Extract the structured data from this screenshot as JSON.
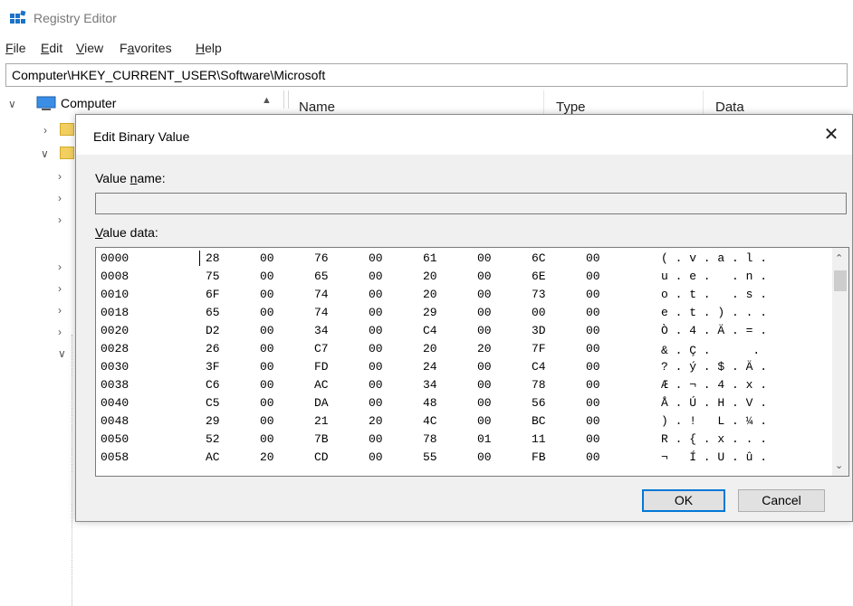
{
  "window": {
    "title": "Registry Editor"
  },
  "menu": [
    {
      "label": "File",
      "underline": "F"
    },
    {
      "label": "Edit",
      "underline": "E"
    },
    {
      "label": "View",
      "underline": "V"
    },
    {
      "label": "Favorites",
      "underline": "a"
    },
    {
      "label": "Help",
      "underline": "H"
    }
  ],
  "address": "Computer\\HKEY_CURRENT_USER\\Software\\Microsoft",
  "tree": {
    "root_label": "Computer"
  },
  "list_headers": {
    "name": "Name",
    "type": "Type",
    "data": "Data"
  },
  "dialog": {
    "title": "Edit Binary Value",
    "value_name_label": "Value name:",
    "value_name": "",
    "value_data_label": "Value data:",
    "ok_label": "OK",
    "cancel_label": "Cancel",
    "rows": [
      {
        "addr": "0000",
        "bytes": [
          "28",
          "00",
          "76",
          "00",
          "61",
          "00",
          "6C",
          "00"
        ],
        "ascii": "( . v . a . l ."
      },
      {
        "addr": "0008",
        "bytes": [
          "75",
          "00",
          "65",
          "00",
          "20",
          "00",
          "6E",
          "00"
        ],
        "ascii": "u . e .   . n ."
      },
      {
        "addr": "0010",
        "bytes": [
          "6F",
          "00",
          "74",
          "00",
          "20",
          "00",
          "73",
          "00"
        ],
        "ascii": "o . t .   . s ."
      },
      {
        "addr": "0018",
        "bytes": [
          "65",
          "00",
          "74",
          "00",
          "29",
          "00",
          "00",
          "00"
        ],
        "ascii": "e . t . ) . . ."
      },
      {
        "addr": "0020",
        "bytes": [
          "D2",
          "00",
          "34",
          "00",
          "C4",
          "00",
          "3D",
          "00"
        ],
        "ascii": "Ò . 4 . Ä . = ."
      },
      {
        "addr": "0028",
        "bytes": [
          "26",
          "00",
          "C7",
          "00",
          "20",
          "20",
          "7F",
          "00"
        ],
        "ascii": "& . Ç .      ."
      },
      {
        "addr": "0030",
        "bytes": [
          "3F",
          "00",
          "FD",
          "00",
          "24",
          "00",
          "C4",
          "00"
        ],
        "ascii": "? . ý . $ . Ä ."
      },
      {
        "addr": "0038",
        "bytes": [
          "C6",
          "00",
          "AC",
          "00",
          "34",
          "00",
          "78",
          "00"
        ],
        "ascii": "Æ . ¬ . 4 . x ."
      },
      {
        "addr": "0040",
        "bytes": [
          "C5",
          "00",
          "DA",
          "00",
          "48",
          "00",
          "56",
          "00"
        ],
        "ascii": "Å . Ú . H . V ."
      },
      {
        "addr": "0048",
        "bytes": [
          "29",
          "00",
          "21",
          "20",
          "4C",
          "00",
          "BC",
          "00"
        ],
        "ascii": ") . !   L . ¼ ."
      },
      {
        "addr": "0050",
        "bytes": [
          "52",
          "00",
          "7B",
          "00",
          "78",
          "01",
          "11",
          "00"
        ],
        "ascii": "R . { . x . . ."
      },
      {
        "addr": "0058",
        "bytes": [
          "AC",
          "20",
          "CD",
          "00",
          "55",
          "00",
          "FB",
          "00"
        ],
        "ascii": "¬   Í . U . û ."
      }
    ]
  }
}
